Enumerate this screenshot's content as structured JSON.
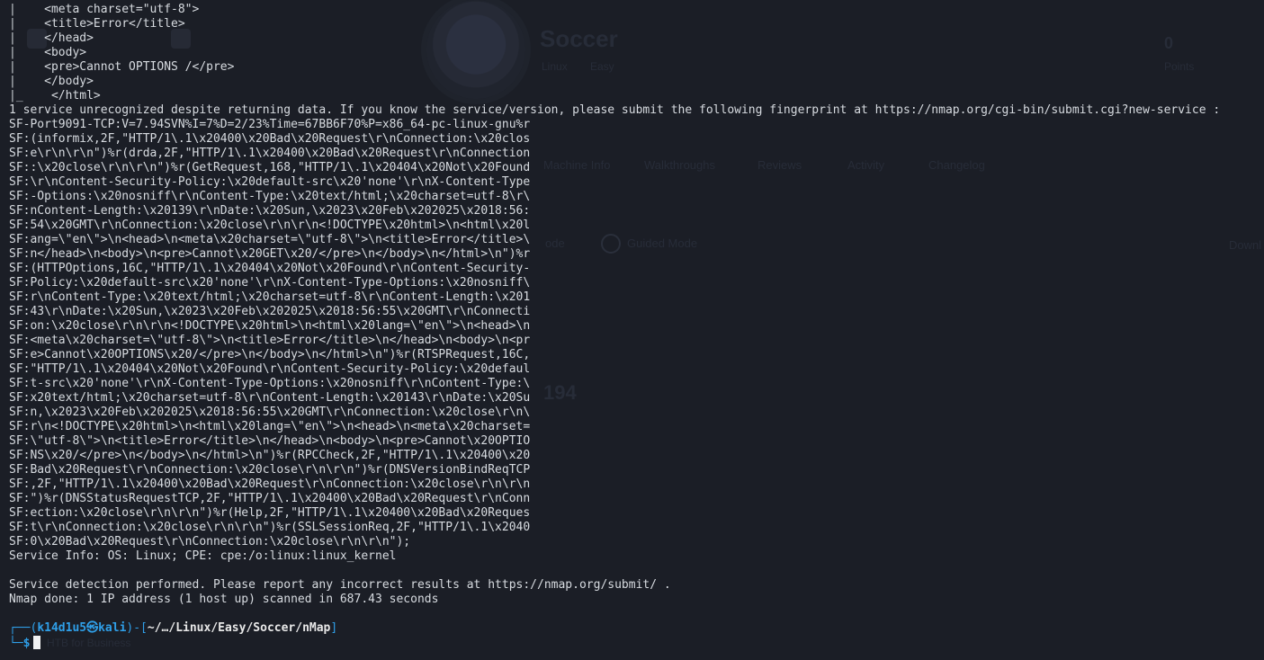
{
  "background": {
    "site_title": "Soccer",
    "os_label": "Linux",
    "difficulty_label": "Easy",
    "points_value": "0",
    "points_label": "Points",
    "tabs": [
      "Machine Info",
      "Walkthroughs",
      "Reviews",
      "Activity",
      "Changelog"
    ],
    "mode_label": "Guided Mode",
    "mode_prefix": "ode",
    "download_label": "Downl",
    "stat_value": "194",
    "faint_footer": "HTB for Business"
  },
  "html_snippet_lines": [
    "    <meta charset=\"utf-8\">",
    "    <title>Error</title>",
    "    </head>",
    "    <body>",
    "    <pre>Cannot OPTIONS /</pre>",
    "    </body>",
    "    </html>"
  ],
  "output_lines": [
    "1 service unrecognized despite returning data. If you know the service/version, please submit the following fingerprint at https://nmap.org/cgi-bin/submit.cgi?new-service :",
    "SF-Port9091-TCP:V=7.94SVN%I=7%D=2/23%Time=67BB6F70%P=x86_64-pc-linux-gnu%r",
    "SF:(informix,2F,\"HTTP/1\\.1\\x20400\\x20Bad\\x20Request\\r\\nConnection:\\x20clos",
    "SF:e\\r\\n\\r\\n\")%r(drda,2F,\"HTTP/1\\.1\\x20400\\x20Bad\\x20Request\\r\\nConnection",
    "SF::\\x20close\\r\\n\\r\\n\")%r(GetRequest,168,\"HTTP/1\\.1\\x20404\\x20Not\\x20Found",
    "SF:\\r\\nContent-Security-Policy:\\x20default-src\\x20'none'\\r\\nX-Content-Type",
    "SF:-Options:\\x20nosniff\\r\\nContent-Type:\\x20text/html;\\x20charset=utf-8\\r\\",
    "SF:nContent-Length:\\x20139\\r\\nDate:\\x20Sun,\\x2023\\x20Feb\\x202025\\x2018:56:",
    "SF:54\\x20GMT\\r\\nConnection:\\x20close\\r\\n\\r\\n<!DOCTYPE\\x20html>\\n<html\\x20l",
    "SF:ang=\\\"en\\\">\\n<head>\\n<meta\\x20charset=\\\"utf-8\\\">\\n<title>Error</title>\\",
    "SF:n</head>\\n<body>\\n<pre>Cannot\\x20GET\\x20/</pre>\\n</body>\\n</html>\\n\")%r",
    "SF:(HTTPOptions,16C,\"HTTP/1\\.1\\x20404\\x20Not\\x20Found\\r\\nContent-Security-",
    "SF:Policy:\\x20default-src\\x20'none'\\r\\nX-Content-Type-Options:\\x20nosniff\\",
    "SF:r\\nContent-Type:\\x20text/html;\\x20charset=utf-8\\r\\nContent-Length:\\x201",
    "SF:43\\r\\nDate:\\x20Sun,\\x2023\\x20Feb\\x202025\\x2018:56:55\\x20GMT\\r\\nConnecti",
    "SF:on:\\x20close\\r\\n\\r\\n<!DOCTYPE\\x20html>\\n<html\\x20lang=\\\"en\\\">\\n<head>\\n",
    "SF:<meta\\x20charset=\\\"utf-8\\\">\\n<title>Error</title>\\n</head>\\n<body>\\n<pr",
    "SF:e>Cannot\\x20OPTIONS\\x20/</pre>\\n</body>\\n</html>\\n\")%r(RTSPRequest,16C,",
    "SF:\"HTTP/1\\.1\\x20404\\x20Not\\x20Found\\r\\nContent-Security-Policy:\\x20defaul",
    "SF:t-src\\x20'none'\\r\\nX-Content-Type-Options:\\x20nosniff\\r\\nContent-Type:\\",
    "SF:x20text/html;\\x20charset=utf-8\\r\\nContent-Length:\\x20143\\r\\nDate:\\x20Su",
    "SF:n,\\x2023\\x20Feb\\x202025\\x2018:56:55\\x20GMT\\r\\nConnection:\\x20close\\r\\n\\",
    "SF:r\\n<!DOCTYPE\\x20html>\\n<html\\x20lang=\\\"en\\\">\\n<head>\\n<meta\\x20charset=",
    "SF:\\\"utf-8\\\">\\n<title>Error</title>\\n</head>\\n<body>\\n<pre>Cannot\\x20OPTIO",
    "SF:NS\\x20/</pre>\\n</body>\\n</html>\\n\")%r(RPCCheck,2F,\"HTTP/1\\.1\\x20400\\x20",
    "SF:Bad\\x20Request\\r\\nConnection:\\x20close\\r\\n\\r\\n\")%r(DNSVersionBindReqTCP",
    "SF:,2F,\"HTTP/1\\.1\\x20400\\x20Bad\\x20Request\\r\\nConnection:\\x20close\\r\\n\\r\\n",
    "SF:\")%r(DNSStatusRequestTCP,2F,\"HTTP/1\\.1\\x20400\\x20Bad\\x20Request\\r\\nConn",
    "SF:ection:\\x20close\\r\\n\\r\\n\")%r(Help,2F,\"HTTP/1\\.1\\x20400\\x20Bad\\x20Reques",
    "SF:t\\r\\nConnection:\\x20close\\r\\n\\r\\n\")%r(SSLSessionReq,2F,\"HTTP/1\\.1\\x2040",
    "SF:0\\x20Bad\\x20Request\\r\\nConnection:\\x20close\\r\\n\\r\\n\");",
    "Service Info: OS: Linux; CPE: cpe:/o:linux:linux_kernel",
    "",
    "Service detection performed. Please report any incorrect results at https://nmap.org/submit/ .",
    "Nmap done: 1 IP address (1 host up) scanned in 687.43 seconds"
  ],
  "prompt": {
    "open": "┌──(",
    "user_host": "k14d1u5㉿kali",
    "mid": ")-[",
    "path": "~/…/Linux/Easy/Soccer/nMap",
    "close": "]",
    "line2": "└─",
    "symbol": "$"
  },
  "colors": {
    "background": "#1b1e26",
    "text": "#d7dbe0",
    "prompt_blue": "#2f9fe8"
  }
}
